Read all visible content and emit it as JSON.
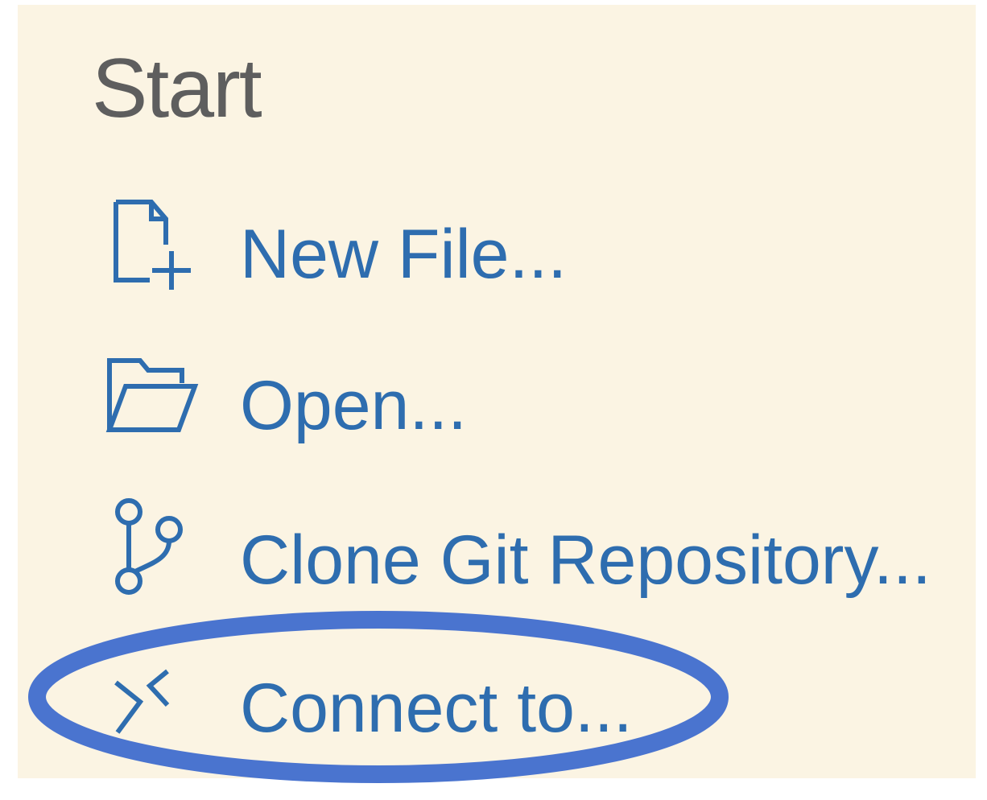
{
  "start": {
    "title": "Start",
    "items": [
      {
        "label": "New File...",
        "icon": "new-file-icon"
      },
      {
        "label": "Open...",
        "icon": "folder-open-icon"
      },
      {
        "label": "Clone Git Repository...",
        "icon": "git-branch-icon"
      },
      {
        "label": "Connect to...",
        "icon": "remote-connect-icon"
      }
    ]
  },
  "colors": {
    "background": "#fbf4e3",
    "title": "#5e5e5e",
    "link": "#2e6daf",
    "highlight": "#4a74cf"
  }
}
